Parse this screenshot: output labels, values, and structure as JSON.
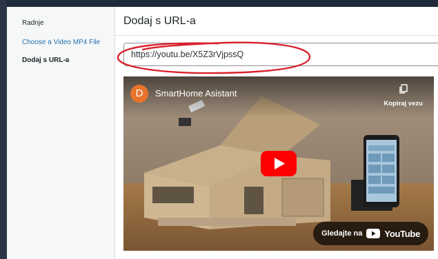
{
  "sidebar": {
    "heading": "Radnje",
    "items": [
      {
        "label": "Choose a Video MP4 File",
        "active": false
      },
      {
        "label": "Dodaj s URL-a",
        "active": true
      }
    ]
  },
  "main": {
    "title": "Dodaj s URL-a",
    "url_input": {
      "value": "https://youtu.be/X5Z3rVjpssQ"
    }
  },
  "video": {
    "channel_initial": "D",
    "title": "SmartHome Asistant",
    "copy_link_label": "Kopiraj vezu",
    "watch_on_label": "Gledajte na",
    "brand": "YouTube",
    "icons": {
      "copy": "copy-icon",
      "play": "play-icon",
      "youtube": "youtube-logo-icon"
    }
  },
  "colors": {
    "link": "#2271b1",
    "annotation": "#d9202c",
    "youtube_red": "#ff0000",
    "avatar": "#e8742c"
  }
}
